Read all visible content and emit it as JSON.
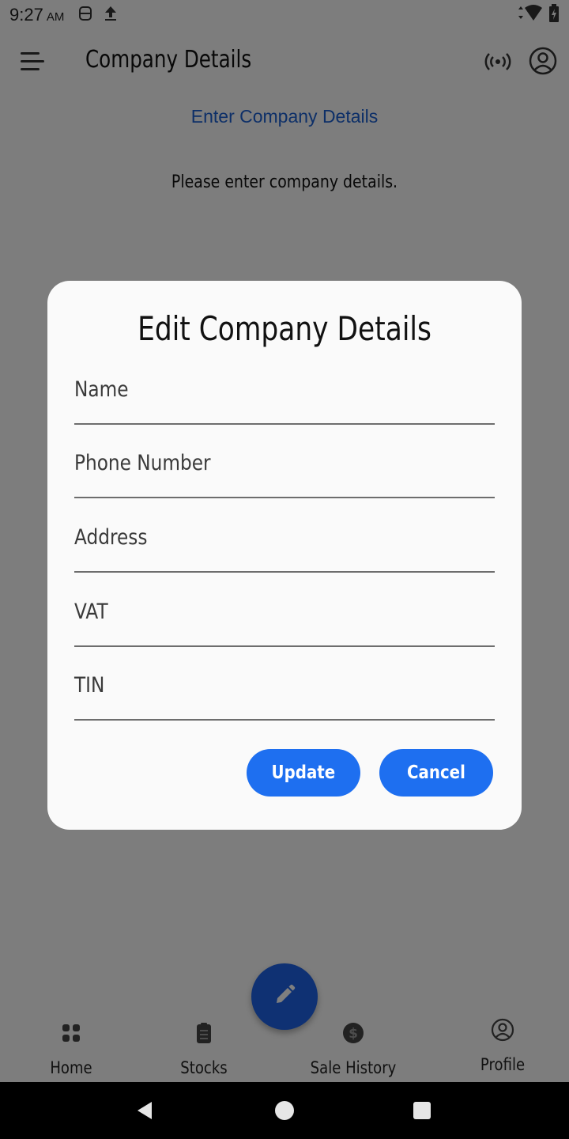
{
  "status_bar": {
    "time": "9:27",
    "ampm": "AM"
  },
  "app_bar": {
    "title": "Company Details"
  },
  "page": {
    "heading": "Enter Company Details",
    "subtext": "Please enter company details."
  },
  "dialog": {
    "title": "Edit Company Details",
    "fields": [
      {
        "label": "Name",
        "value": ""
      },
      {
        "label": "Phone Number",
        "value": ""
      },
      {
        "label": "Address",
        "value": ""
      },
      {
        "label": "VAT",
        "value": ""
      },
      {
        "label": "TIN",
        "value": ""
      }
    ],
    "update_label": "Update",
    "cancel_label": "Cancel"
  },
  "bottom_nav": {
    "items": [
      {
        "label": "Home",
        "icon": "grid-icon"
      },
      {
        "label": "Stocks",
        "icon": "clipboard-icon"
      },
      {
        "label": "Sale History",
        "icon": "dollar-icon"
      },
      {
        "label": "Profile",
        "icon": "account-icon"
      }
    ]
  },
  "fab": {
    "icon": "pencil-icon"
  },
  "colors": {
    "accent": "#1e6ff0",
    "heading": "#1a5fd0",
    "scrim": "rgba(0,0,0,0.5)"
  }
}
